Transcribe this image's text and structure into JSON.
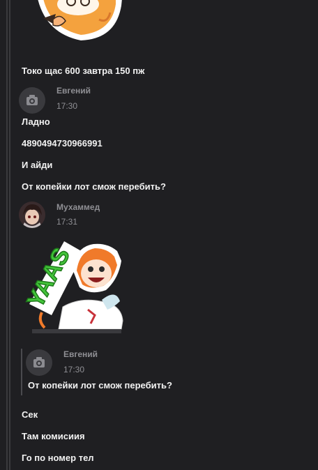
{
  "messages_top": [
    {
      "text": "Токо щас 600 завтра 150 пж"
    }
  ],
  "post_evgeny": {
    "author": "Евгений",
    "time": "17:30",
    "avatar_icon": "camera-icon",
    "lines": [
      "Ладно",
      "4890494730966991",
      "И айди",
      "От копейки лот смож перебить?"
    ]
  },
  "post_mukhammed": {
    "author": "Мухаммед",
    "time": "17:31",
    "sticker_text": "YAAS",
    "quote": {
      "author": "Евгений",
      "time": "17:30",
      "avatar_icon": "camera-icon",
      "text": "От копейки лот смож перебить?"
    },
    "lines": [
      "Сек",
      "Там комисиия",
      "Го по номер тел"
    ]
  },
  "colors": {
    "background": "#1f1f22",
    "text": "#f2f2f2",
    "muted": "#8f8f94",
    "sticker_green": "#43c43a",
    "sticker_orange": "#f07a2a"
  }
}
